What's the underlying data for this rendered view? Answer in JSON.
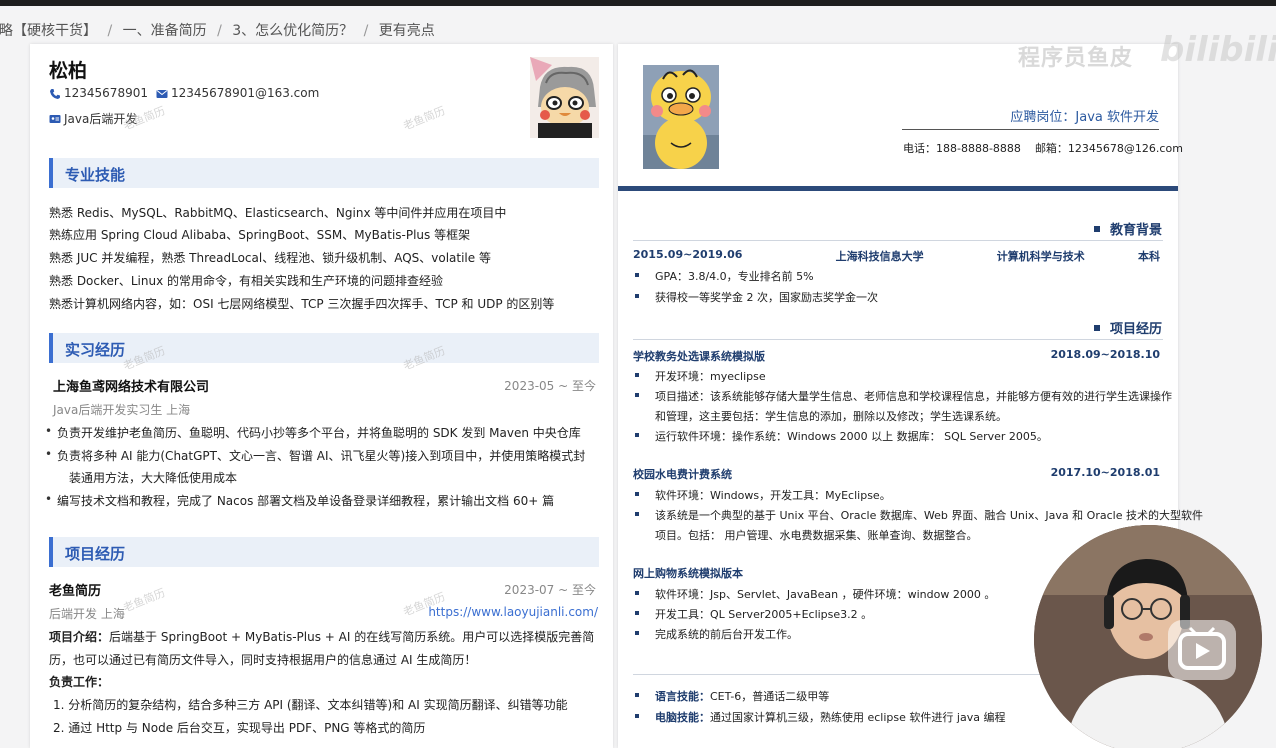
{
  "breadcrumb": {
    "items": [
      "攻略【硬核干货】",
      "一、准备简历",
      "3、怎么优化简历？",
      "更有亮点"
    ],
    "sep": "/"
  },
  "overlay": {
    "watermark": "程序员鱼皮",
    "logo": "bilibili"
  },
  "left": {
    "name": "松柏",
    "phone": "12345678901",
    "email": "12345678901@163.com",
    "role": "Java后端开发",
    "watermark": "老鱼简历",
    "skills": {
      "title": "专业技能",
      "lines": [
        "熟悉 Redis、MySQL、RabbitMQ、Elasticsearch、Nginx 等中间件并应用在项目中",
        "熟练应用 Spring Cloud Alibaba、SpringBoot、SSM、MyBatis-Plus 等框架",
        "熟悉 JUC 并发编程，熟悉 ThreadLocal、线程池、锁升级机制、AQS、volatile 等",
        "熟悉 Docker、Linux 的常用命令，有相关实践和生产环境的问题排查经验",
        "熟悉计算机网络内容，如：OSI 七层网络模型、TCP 三次握手四次挥手、TCP 和 UDP 的区别等"
      ]
    },
    "internship": {
      "title": "实习经历",
      "company": "上海鱼鸢网络技术有限公司",
      "date": "2023-05 ~ 至今",
      "position": "Java后端开发实习生  上海",
      "bullets": [
        "负责开发维护老鱼简历、鱼聪明、代码小抄等多个平台，并将鱼聪明的 SDK 发到 Maven 中央仓库",
        "负责将多种 AI 能力(ChatGPT、文心一言、智谱 AI、讯飞星火等)接入到项目中，并使用策略模式封",
        "编写技术文档和教程，完成了 Nacos 部署文档及单设备登录详细教程，累计输出文档 60+ 篇"
      ],
      "bullet2_cont": "装通用方法，大大降低使用成本"
    },
    "project": {
      "title": "项目经历",
      "name": "老鱼简历",
      "date": "2023-07 ~ 至今",
      "role": "后端开发  上海",
      "link": "https://www.laoyujianli.com/",
      "intro_label": "项目介绍：",
      "intro": "后端基于 SpringBoot + MyBatis-Plus + AI 的在线写简历系统。用户可以选择模版完善简",
      "intro_cont": "历，也可以通过已有简历文件导入，同时支持根据用户的信息通过 AI 生成简历！",
      "duty_label": "负责工作：",
      "duties": [
        "1. 分析简历的复杂结构，结合多种三方 API (翻译、文本纠错等)和 AI 实现简历翻译、纠错等功能",
        "2. 通过 Http 与 Node 后台交互，实现导出 PDF、PNG 等格式的简历"
      ]
    }
  },
  "right": {
    "position": "应聘岗位：Java 软件开发",
    "phone": "电话：188-8888-8888",
    "email": "邮箱：12345678@126.com",
    "education": {
      "title": "教育背景",
      "period": "2015.09~2019.06",
      "school": "上海科技信息大学",
      "major": "计算机科学与技术",
      "degree": "本科",
      "bullets": [
        "GPA：3.8/4.0，专业排名前 5%",
        "获得校一等奖学金 2 次，国家励志奖学金一次"
      ]
    },
    "projects": {
      "title": "项目经历",
      "items": [
        {
          "name": "学校教务处选课系统模拟版",
          "date": "2018.09~2018.10",
          "bullets": [
            "开发环境：myeclipse",
            "项目描述：该系统能够存储大量学生信息、老师信息和学校课程信息，并能够方便有效的进行学生选课操作",
            "运行软件环境：操作系统：Windows 2000 以上  数据库：  SQL Server 2005。"
          ],
          "cont": "和管理，这主要包括：学生信息的添加，删除以及修改；学生选课系统。"
        },
        {
          "name": "校园水电费计费系统",
          "date": "2017.10~2018.01",
          "bullets": [
            "软件环境：Windows，开发工具：MyEclipse。",
            "该系统是一个典型的基于 Unix 平台、Oracle 数据库、Web 界面、融合 Unix、Java 和 Oracle 技术的大型软件"
          ],
          "cont": "项目。包括：  用户管理、水电费数据采集、账单查询、数据整合。"
        },
        {
          "name": "网上购物系统模拟版本",
          "bullets": [
            "软件环境：Jsp、Servlet、JavaBean ，硬件环境：window 2000 。",
            "开发工具：QL Server2005+Eclipse3.2 。",
            "完成系统的前后台开发工作。"
          ]
        }
      ]
    },
    "skills": [
      {
        "label": "语言技能：",
        "text": "CET-6，普通话二级甲等"
      },
      {
        "label": "电脑技能：",
        "text": "通过国家计算机三级，熟练使用 eclipse 软件进行 java 编程"
      }
    ]
  }
}
